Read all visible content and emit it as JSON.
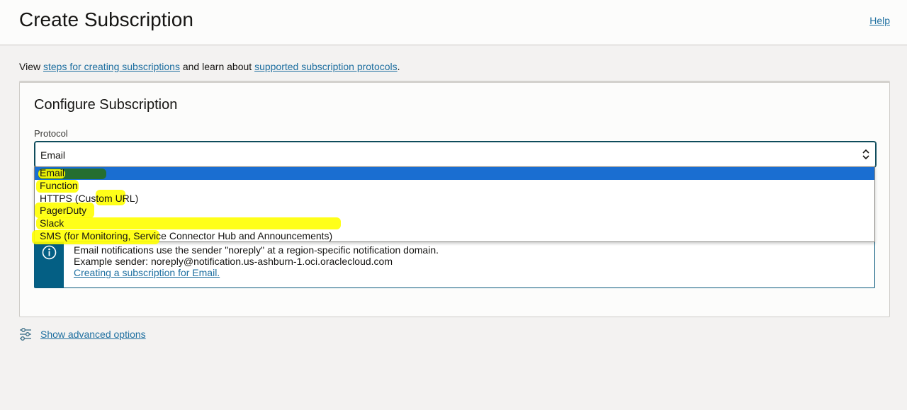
{
  "header": {
    "title": "Create Subscription",
    "help_label": "Help"
  },
  "intro": {
    "prefix": "View ",
    "link1": "steps for creating subscriptions",
    "middle": " and learn about ",
    "link2": "supported subscription protocols",
    "suffix": "."
  },
  "card": {
    "title": "Configure Subscription",
    "protocol_label": "Protocol",
    "protocol_value": "Email"
  },
  "dropdown": {
    "options": [
      "Email",
      "Function",
      "HTTPS (Custom URL)",
      "PagerDuty",
      "Slack",
      "SMS (for Monitoring, Service Connector Hub and Announcements)"
    ],
    "selected": "Email"
  },
  "info": {
    "line1": "Email notifications use the sender \"noreply\" at a region-specific notification domain.",
    "line2": "Example sender: noreply@notification.us-ashburn-1.oci.oraclecloud.com",
    "link": "Creating a subscription for Email."
  },
  "advanced": {
    "label": "Show advanced options"
  },
  "colors": {
    "link": "#1e6fa0",
    "selected_option": "#1a6ed1",
    "info_strip": "#045f84",
    "highlight": "#ffff00"
  }
}
